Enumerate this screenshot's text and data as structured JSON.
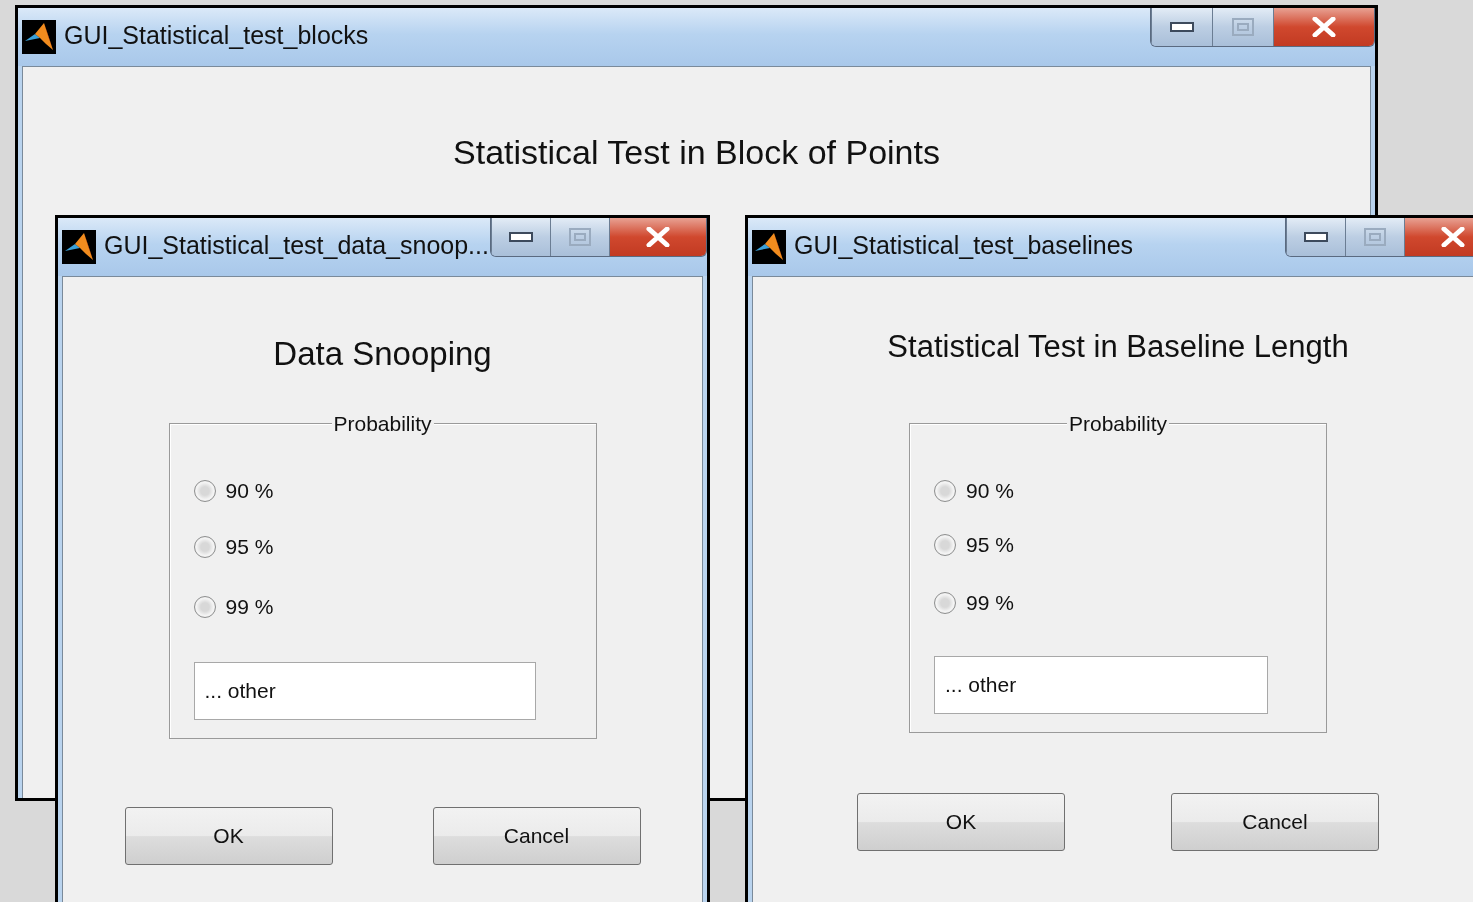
{
  "main_window": {
    "title": "GUI_Statistical_test_blocks",
    "heading": "Statistical Test in Block of Points"
  },
  "dialogs": [
    {
      "title": "GUI_Statistical_test_data_snoop...",
      "heading": "Data Snooping",
      "group_label": "Probability",
      "options": [
        {
          "label": "90 %",
          "selected": false
        },
        {
          "label": "95 %",
          "selected": false
        },
        {
          "label": "99 %",
          "selected": false
        }
      ],
      "other_field": {
        "value": "... other"
      },
      "buttons": [
        "OK",
        "Cancel"
      ]
    },
    {
      "title": "GUI_Statistical_test_baselines",
      "heading": "Statistical Test in Baseline Length",
      "group_label": "Probability",
      "options": [
        {
          "label": "90 %",
          "selected": false
        },
        {
          "label": "95 %",
          "selected": false
        },
        {
          "label": "99 %",
          "selected": false
        }
      ],
      "other_field": {
        "value": "... other"
      },
      "buttons": [
        "OK",
        "Cancel"
      ]
    }
  ]
}
